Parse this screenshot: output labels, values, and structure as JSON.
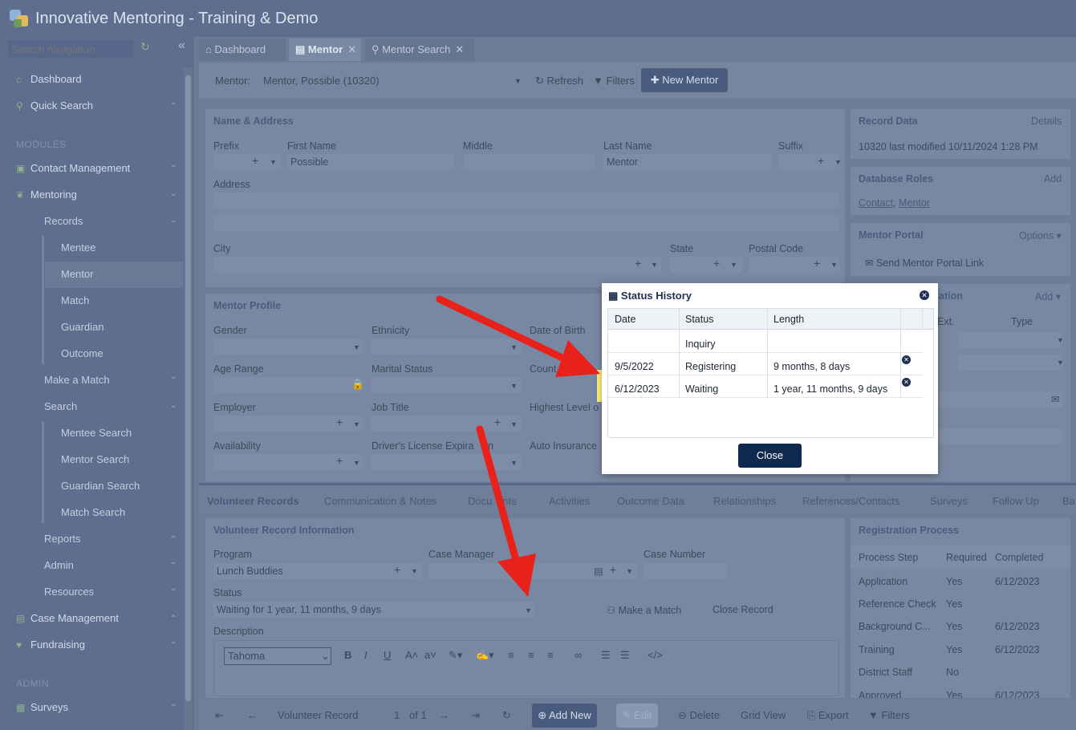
{
  "app": {
    "title": "Innovative Mentoring - Training & Demo"
  },
  "sidebar": {
    "search_placeholder": "Search navigation",
    "items": [
      {
        "label": "Dashboard"
      },
      {
        "label": "Quick Search"
      },
      {
        "label": "MODULES"
      },
      {
        "label": "Contact Management"
      },
      {
        "label": "Mentoring"
      },
      {
        "label": "Records"
      },
      {
        "label": "Mentee"
      },
      {
        "label": "Mentor"
      },
      {
        "label": "Match"
      },
      {
        "label": "Guardian"
      },
      {
        "label": "Outcome"
      },
      {
        "label": "Make a Match"
      },
      {
        "label": "Search"
      },
      {
        "label": "Mentee Search"
      },
      {
        "label": "Mentor Search"
      },
      {
        "label": "Guardian Search"
      },
      {
        "label": "Match Search"
      },
      {
        "label": "Reports"
      },
      {
        "label": "Admin"
      },
      {
        "label": "Resources"
      },
      {
        "label": "Case Management"
      },
      {
        "label": "Fundraising"
      },
      {
        "label": "ADMIN"
      },
      {
        "label": "Surveys"
      }
    ]
  },
  "tabs": [
    {
      "label": "Dashboard"
    },
    {
      "label": "Mentor"
    },
    {
      "label": "Mentor Search"
    }
  ],
  "toolbar": {
    "mentor_label": "Mentor:",
    "mentor_value": "Mentor, Possible (10320)",
    "refresh": "Refresh",
    "filters": "Filters",
    "new_mentor": "New Mentor"
  },
  "name_address": {
    "title": "Name & Address",
    "prefix": "Prefix",
    "first_name": "First Name",
    "first_name_value": "Possible",
    "middle": "Middle",
    "last_name": "Last Name",
    "last_name_value": "Mentor",
    "suffix": "Suffix",
    "address": "Address",
    "city": "City",
    "state": "State",
    "postal_code": "Postal Code"
  },
  "record_data": {
    "title": "Record Data",
    "details": "Details",
    "text": "10320 last modified 10/11/2024 1:28 PM"
  },
  "database_roles": {
    "title": "Database Roles",
    "add": "Add",
    "contact": "Contact",
    "sep": ", ",
    "mentor": "Mentor"
  },
  "mentor_portal": {
    "title": "Mentor Portal",
    "options": "Options",
    "send_link": "Send Mentor Portal Link"
  },
  "partial_panel": {
    "title_fragment": "ation",
    "add": "Add",
    "ext": "Ext.",
    "type": "Type"
  },
  "mentor_profile": {
    "title": "Mentor Profile",
    "gender": "Gender",
    "ethnicity": "Ethnicity",
    "dob": "Date of Birth",
    "age_range": "Age Range",
    "marital_status": "Marital Status",
    "country": "Count",
    "employer": "Employer",
    "job_title": "Job Title",
    "highest_level": "Highest Level o",
    "availability": "Availability",
    "drivers_license": "Driver's License Expira",
    "drivers_license_tail": "n",
    "auto_insurance": "Auto Insurance"
  },
  "bottom_tabs": [
    {
      "label": "Volunteer Records"
    },
    {
      "label": "Communication & Notes"
    },
    {
      "label": "Docu"
    },
    {
      "label": "ents"
    },
    {
      "label": "Activities"
    },
    {
      "label": "Outcome Data"
    },
    {
      "label": "Relationships"
    },
    {
      "label": "References/Contacts"
    },
    {
      "label": "Surveys"
    },
    {
      "label": "Follow Up"
    },
    {
      "label": "Ba"
    }
  ],
  "volunteer_record": {
    "title": "Volunteer Record Information",
    "program": "Program",
    "program_value": "Lunch Buddies",
    "case_manager": "Case Manager",
    "case_number": "Case Number",
    "status": "Status",
    "status_value": "Waiting for 1 year, 11 months, 9 days",
    "make_match": "Make a Match",
    "close_record": "Close Record",
    "description": "Description",
    "font_value": "Tahoma"
  },
  "registration": {
    "title": "Registration Process",
    "headers": [
      "Process Step",
      "Required",
      "Completed"
    ],
    "rows": [
      [
        "Application",
        "Yes",
        "6/12/2023"
      ],
      [
        "Reference Check",
        "Yes",
        ""
      ],
      [
        "Background C...",
        "Yes",
        "6/12/2023"
      ],
      [
        "Training",
        "Yes",
        "6/12/2023"
      ],
      [
        "District Staff",
        "No",
        ""
      ],
      [
        "Approved",
        "Yes",
        "6/12/2023"
      ]
    ]
  },
  "bottombar": {
    "record_label": "Volunteer Record",
    "page": "1",
    "of": "of 1",
    "add_new": "Add New",
    "edit": "Edit",
    "delete": "Delete",
    "grid_view": "Grid View",
    "export": "Export",
    "filters": "Filters"
  },
  "status_history": {
    "title": "Status History",
    "headers": [
      "Date",
      "Status",
      "Length"
    ],
    "rows": [
      {
        "date": "",
        "status": "Inquiry",
        "length": ""
      },
      {
        "date": "9/5/2022",
        "status": "Registering",
        "length": "9 months, 8 days"
      },
      {
        "date": "6/12/2023",
        "status": "Waiting",
        "length": "1 year, 11 months, 9 days"
      }
    ],
    "close": "Close"
  },
  "colors": {
    "modal_header": "#1f2f4f",
    "close_button": "#0e2a4f",
    "highlight": "#fff176",
    "arrow": "#e8211a"
  }
}
